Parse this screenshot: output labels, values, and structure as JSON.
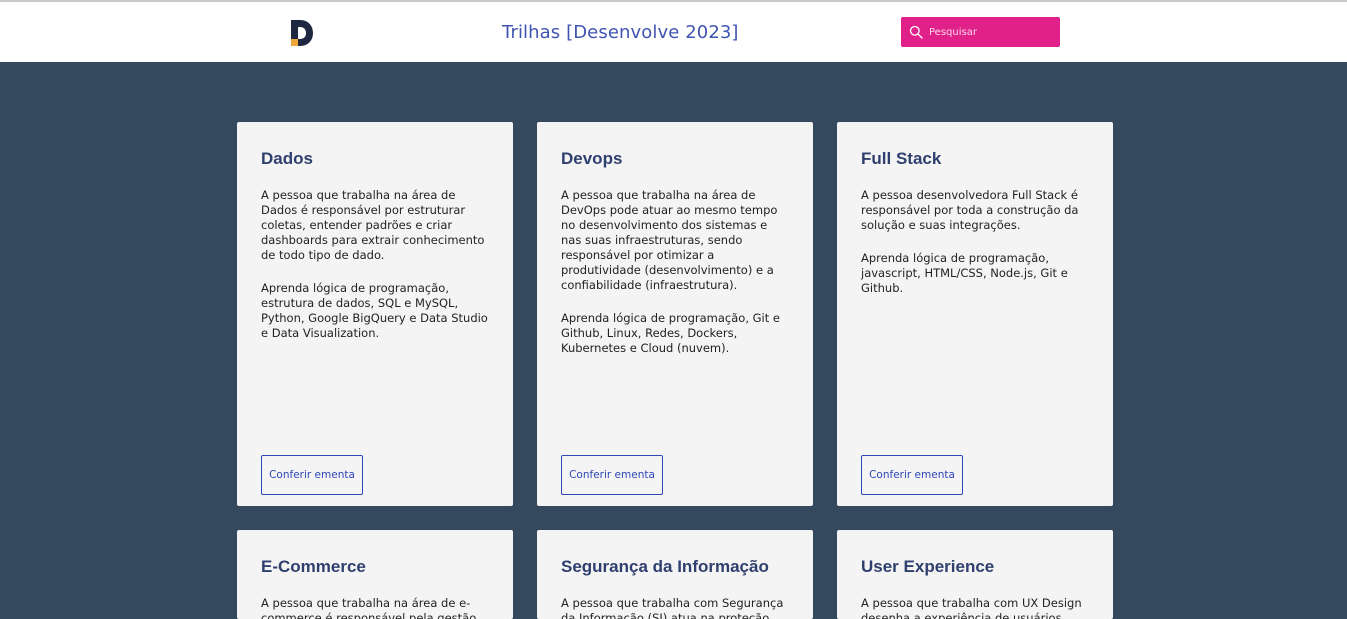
{
  "header": {
    "title": "Trilhas [Desenvolve 2023]",
    "search_placeholder": "Pesquisar",
    "logo_letter": "D"
  },
  "colors": {
    "background": "#34495e",
    "accent": "#e0218a",
    "title": "#4054b2",
    "card": "#f4f4f4"
  },
  "cards": [
    {
      "title": "Dados",
      "description": "A pessoa que trabalha na área de Dados é responsável por estruturar coletas, entender padrões e criar dashboards para extrair conhecimento de todo tipo de dado.",
      "learn": "Aprenda lógica de programação, estrutura de dados, SQL e MySQL, Python, Google BigQuery e Data Studio e Data Visualization.",
      "button": "Conferir ementa"
    },
    {
      "title": "Devops",
      "description": "A pessoa que trabalha na área de DevOps pode atuar ao mesmo tempo no desenvolvimento dos sistemas e nas suas infraestruturas, sendo responsável por otimizar a produtividade (desenvolvimento) e a confiabilidade (infraestrutura).",
      "learn": "Aprenda lógica de programação, Git e Github, Linux, Redes, Dockers, Kubernetes e Cloud (nuvem).",
      "button": "Conferir ementa"
    },
    {
      "title": "Full Stack",
      "description": "A pessoa desenvolvedora Full Stack é responsável por toda a construção da solução e suas integrações.",
      "learn": "Aprenda lógica de programação, javascript, HTML/CSS, Node.js, Git e Github.",
      "button": "Conferir ementa"
    },
    {
      "title": "E-Commerce",
      "description": "A pessoa que trabalha na área de e-commerce é responsável pela gestão da",
      "learn": "",
      "button": ""
    },
    {
      "title": "Segurança da Informação",
      "description": "A pessoa que trabalha com Segurança da Informação (SI) atua na proteção dos",
      "learn": "",
      "button": ""
    },
    {
      "title": "User Experience",
      "description": "A pessoa que trabalha com UX Design desenha a experiência de usuários",
      "learn": "",
      "button": ""
    }
  ]
}
